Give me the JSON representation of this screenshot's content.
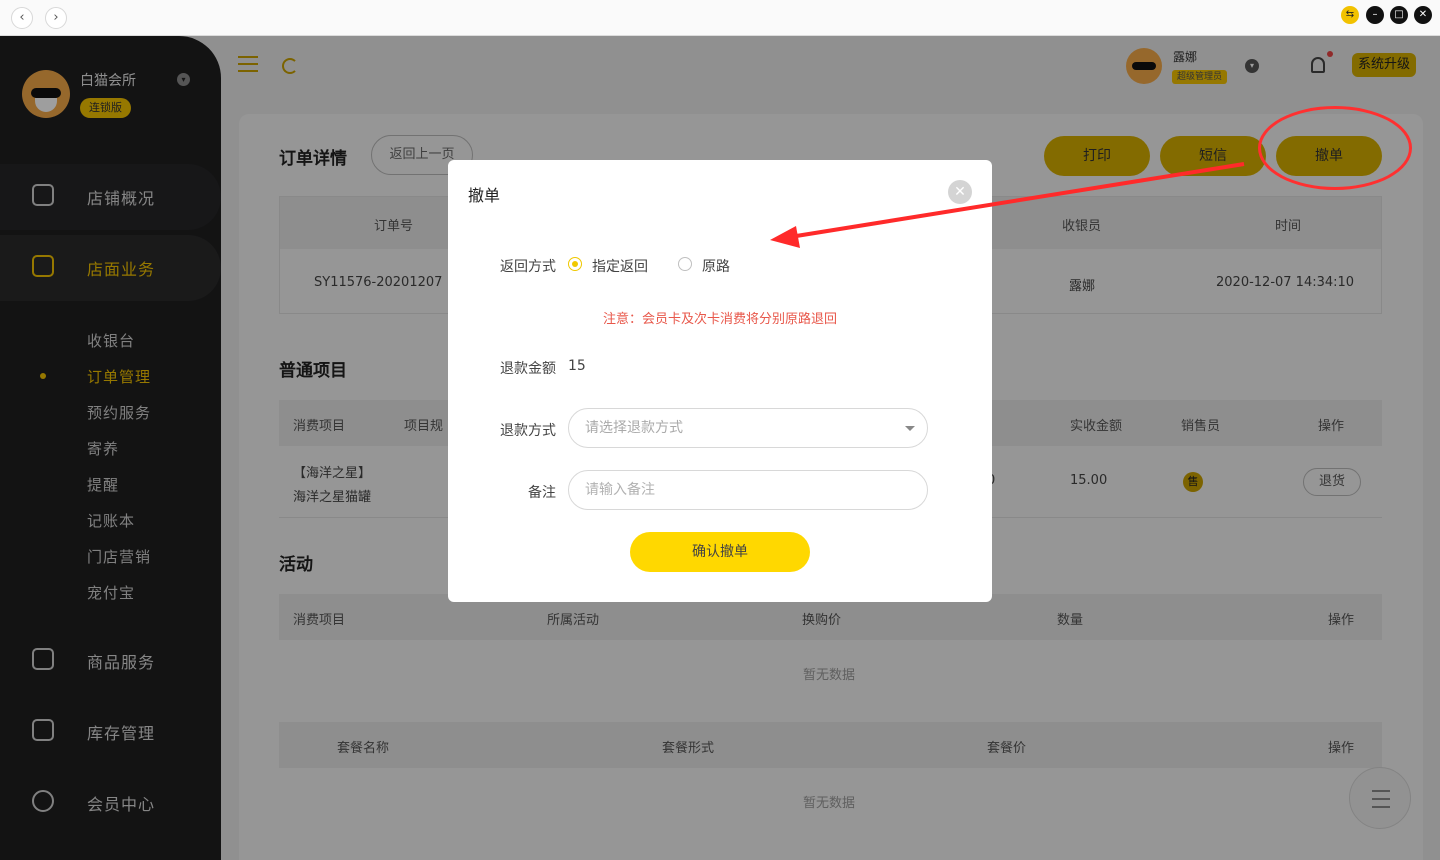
{
  "titlebar": {
    "back_glyph": "‹",
    "forward_glyph": "›",
    "win_icons": [
      "exchange-icon",
      "minimize-icon",
      "maximize-icon",
      "close-icon"
    ]
  },
  "sidebar": {
    "brand_name": "白猫会所",
    "brand_tag": "连锁版",
    "menu": [
      {
        "label": "店铺概况",
        "icon": "monitor-icon"
      },
      {
        "label": "店面业务",
        "icon": "home-icon",
        "active": true
      },
      {
        "label": "商品服务",
        "icon": "bag-icon"
      },
      {
        "label": "库存管理",
        "icon": "box-icon"
      },
      {
        "label": "会员中心",
        "icon": "member-icon"
      }
    ],
    "sub_menu": [
      "收银台",
      "订单管理",
      "预约服务",
      "寄养",
      "提醒",
      "记账本",
      "门店营销",
      "宠付宝"
    ]
  },
  "header": {
    "user_name": "露娜",
    "user_role": "超级管理员",
    "upgrade_label": "系统升级"
  },
  "page": {
    "title": "订单详情",
    "back_label": "返回上一页",
    "actions": [
      "打印",
      "短信",
      "撤单"
    ]
  },
  "order_table": {
    "headers": [
      "订单号",
      "收银员",
      "时间"
    ],
    "row": [
      "SY11576-20201207",
      "露娜",
      "2020-12-07 14:34:10"
    ]
  },
  "items_section": {
    "title": "普通项目",
    "headers": [
      "消费项目",
      "项目规",
      "实收金额",
      "销售员",
      "操作"
    ],
    "row": {
      "item_line1": "【海洋之星】",
      "item_line2": "海洋之星猫罐",
      "hidden_tail": "0",
      "amount": "15.00",
      "seller_badge": "售",
      "action": "退货"
    }
  },
  "activity_section": {
    "title": "活动",
    "headers": [
      "消费项目",
      "所属活动",
      "换购价",
      "数量",
      "操作"
    ],
    "empty": "暂无数据"
  },
  "package_section": {
    "headers": [
      "套餐名称",
      "套餐形式",
      "套餐价",
      "操作"
    ],
    "empty": "暂无数据"
  },
  "modal": {
    "title": "撤单",
    "close_glyph": "✕",
    "return_method_label": "返回方式",
    "return_options": [
      "指定返回",
      "原路"
    ],
    "selected_option": "指定返回",
    "notice": "注意：会员卡及次卡消费将分别原路退回",
    "refund_amount_label": "退款金额",
    "refund_amount": "15",
    "refund_method_label": "退款方式",
    "refund_method_placeholder": "请选择退款方式",
    "remark_label": "备注",
    "remark_placeholder": "请输入备注",
    "confirm_label": "确认撤单"
  },
  "colors": {
    "accent": "#f2c200",
    "sidebar_bg": "#1f1f20",
    "annotation": "#ff3030",
    "notice": "#e8574a"
  }
}
